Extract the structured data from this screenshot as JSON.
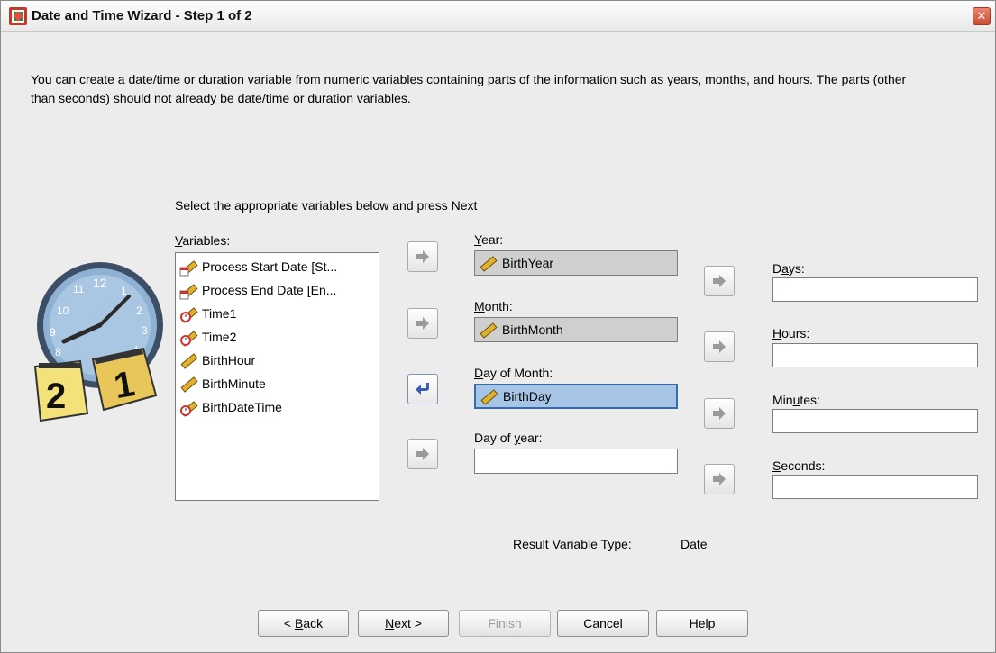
{
  "window": {
    "title": "Date and Time Wizard - Step 1 of 2",
    "close_icon": "close-icon"
  },
  "intro": "You can create a date/time or duration variable from numeric variables containing parts of the information such as years, months, and hours. The parts (other than seconds) should not already be date/time or duration variables.",
  "prompt": "Select the appropriate variables below and press Next",
  "variables": {
    "label_mnemonic": "V",
    "label_rest": "ariables:",
    "items": [
      {
        "label": "Process Start Date [St...",
        "icon": "date-scale-icon"
      },
      {
        "label": "Process End Date [En...",
        "icon": "date-scale-icon"
      },
      {
        "label": "Time1",
        "icon": "time-scale-icon"
      },
      {
        "label": "Time2",
        "icon": "time-scale-icon"
      },
      {
        "label": "BirthHour",
        "icon": "ruler-scale-icon"
      },
      {
        "label": "BirthMinute",
        "icon": "ruler-scale-icon"
      },
      {
        "label": "BirthDateTime",
        "icon": "time-scale-icon"
      }
    ]
  },
  "date_fields": {
    "year": {
      "label_mnemonic": "Y",
      "label_rest": "ear:",
      "value": "BirthYear"
    },
    "month": {
      "label_mnemonic": "M",
      "label_rest": "onth:",
      "value": "BirthMonth"
    },
    "day_of_month": {
      "label_mnemonic": "D",
      "label_rest": "ay of Month:",
      "value": "BirthDay"
    },
    "day_of_year": {
      "label_pre": "Day of ",
      "label_mnemonic": "y",
      "label_post": "ear:",
      "value": ""
    }
  },
  "duration_fields": {
    "days": {
      "label_pre": "D",
      "label_mnemonic": "a",
      "label_post": "ys:"
    },
    "hours": {
      "label_pre": "",
      "label_mnemonic": "H",
      "label_post": "ours:"
    },
    "minutes": {
      "label_pre": "Min",
      "label_mnemonic": "u",
      "label_post": "tes:"
    },
    "seconds": {
      "label_pre": "",
      "label_mnemonic": "S",
      "label_post": "econds:"
    }
  },
  "result": {
    "label": "Result Variable Type:",
    "value": "Date"
  },
  "buttons": {
    "back_prefix": "< ",
    "back_mnemonic": "B",
    "back_rest": "ack",
    "next_mnemonic": "N",
    "next_rest": "ext >",
    "finish": "Finish",
    "cancel": "Cancel",
    "help": "Help"
  },
  "colors": {
    "window_bg": "#ececec",
    "selected_field": "#a6c5e6",
    "filled_field": "#cfcfcf",
    "arrow": "#9a9a9a",
    "arrow_active": "#3a5fb0"
  }
}
